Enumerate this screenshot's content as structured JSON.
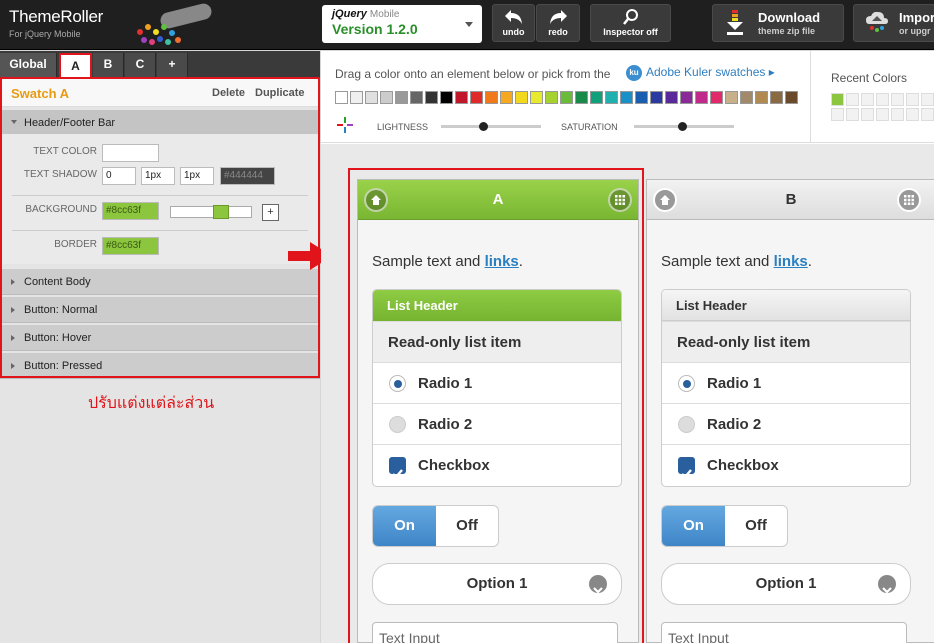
{
  "app": {
    "title": "ThemeRoller",
    "subtitle": "For jQuery Mobile"
  },
  "version": {
    "brand": "jQuery",
    "brand_sub": "Mobile",
    "label": "Version 1.2.0"
  },
  "toolbar": {
    "undo": "undo",
    "redo": "redo",
    "inspector": "Inspector",
    "inspector_state": "off",
    "download": "Download",
    "download_sub": "theme zip file",
    "import": "Impor",
    "import_sub": "or upgr"
  },
  "tabs": [
    "Global",
    "A",
    "B",
    "C",
    "+"
  ],
  "swatch": {
    "name": "Swatch A",
    "delete": "Delete",
    "duplicate": "Duplicate"
  },
  "sections": {
    "header": "Header/Footer Bar",
    "others": [
      "Content Body",
      "Button: Normal",
      "Button: Hover",
      "Button: Pressed"
    ]
  },
  "fields": {
    "text_color": "TEXT COLOR",
    "text_color_value": "",
    "text_shadow": "TEXT SHADOW",
    "shadow_x": "0",
    "shadow_y": "1px",
    "shadow_blur": "1px",
    "shadow_color": "#444444",
    "background": "BACKGROUND",
    "background_value": "#8cc63f",
    "background_level": 0.53,
    "border": "BORDER",
    "border_value": "#8cc63f"
  },
  "annotation": "ปรับแต่งแต่ล่ะส่วน",
  "palette": {
    "instruction": "Drag a color onto an element below or pick from the",
    "kuler": "Adobe Kuler swatches",
    "lightness": "LIGHTNESS",
    "saturation": "SATURATION",
    "lightness_level": 0.42,
    "saturation_level": 0.48,
    "recent": "Recent Colors",
    "colors": [
      "#ffffff",
      "#f0f0f0",
      "#e0e0e0",
      "#cccccc",
      "#999999",
      "#666666",
      "#333333",
      "#000000",
      "#c0182a",
      "#e02a2a",
      "#f07a1a",
      "#f5a820",
      "#f2d81e",
      "#e8ea30",
      "#a5d22e",
      "#6abb3a",
      "#1a8a4a",
      "#10a07a",
      "#20b0b0",
      "#1a90c8",
      "#1a5eb0",
      "#2a3aa0",
      "#5a2a9a",
      "#8a2a9a",
      "#c02a8a",
      "#e02a6a",
      "#c8b08a",
      "#a08a6a",
      "#b08a50",
      "#8a6a40",
      "#6a4a2a"
    ],
    "recent_colors": [
      "#8cc63f"
    ]
  },
  "cards": [
    {
      "letter": "A",
      "sample": "Sample text and ",
      "link": "links",
      "list_header": "List Header",
      "readonly": "Read-only list item",
      "radio1": "Radio 1",
      "radio2": "Radio 2",
      "checkbox": "Checkbox",
      "on": "On",
      "off": "Off",
      "option": "Option 1",
      "text_input": "Text Input"
    },
    {
      "letter": "B",
      "sample": "Sample text and ",
      "link": "links",
      "list_header": "List Header",
      "readonly": "Read-only list item",
      "radio1": "Radio 1",
      "radio2": "Radio 2",
      "checkbox": "Checkbox",
      "on": "On",
      "off": "Off",
      "option": "Option 1",
      "text_input": "Text Input"
    }
  ],
  "accent": {
    "red": "#e0141a",
    "green": "#8cc63f",
    "blue": "#2a7fc0",
    "orange": "#e89b12"
  }
}
